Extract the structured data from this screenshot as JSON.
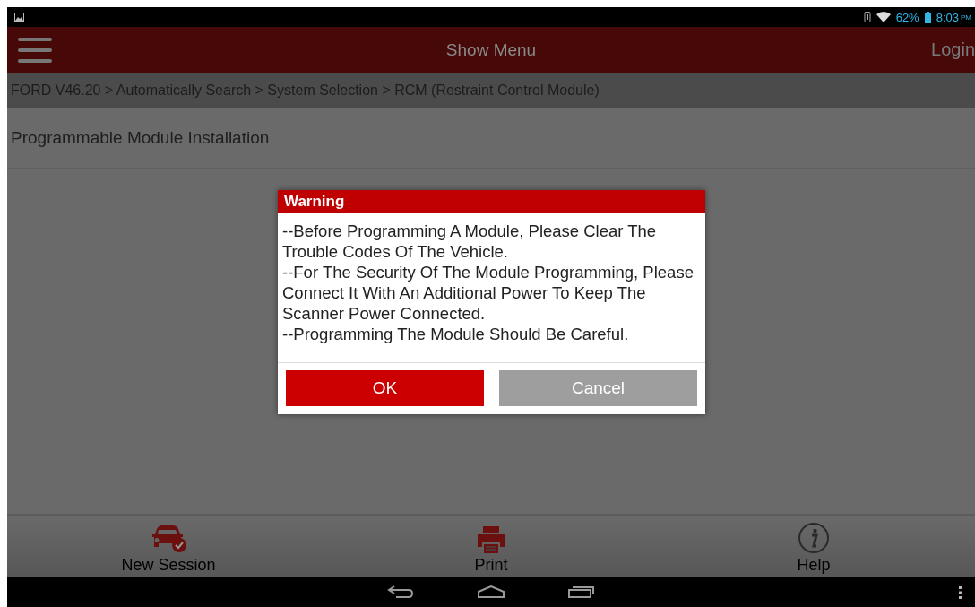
{
  "status_bar": {
    "battery": "62%",
    "time": "8:03",
    "time_suffix": "PM"
  },
  "top_bar": {
    "title": "Show Menu",
    "login": "Login"
  },
  "breadcrumb": "FORD V46.20 > Automatically Search > System Selection > RCM (Restraint Control Module)",
  "page_title": "Programmable Module Installation",
  "dialog": {
    "title": "Warning",
    "paragraphs": [
      "--Before Programming A Module, Please Clear The Trouble Codes Of The Vehicle.",
      "--For The Security Of The Module Programming, Please Connect It With An Additional Power To Keep The Scanner Power Connected.",
      "--Programming The Module Should Be Careful."
    ],
    "buttons": [
      {
        "label": "OK",
        "kind": "primary"
      },
      {
        "label": "Cancel",
        "kind": "secondary"
      }
    ]
  },
  "bottom_bar": [
    {
      "label": "New Session",
      "kind": "car",
      "disabled": false
    },
    {
      "label": "Print",
      "kind": "printer",
      "disabled": false
    },
    {
      "label": "Help",
      "kind": "info",
      "disabled": true
    }
  ]
}
